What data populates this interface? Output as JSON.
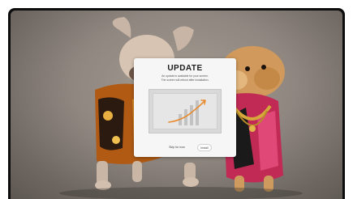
{
  "dialog": {
    "title": "UPDATE",
    "description_line1": "An update is available for your screen.",
    "description_line2": "The screen will reboot after installation.",
    "skip_label": "Skip for now",
    "install_label": "Install"
  },
  "colors": {
    "accent": "#e8892b",
    "dialog_bg": "#f6f6f6",
    "screen_bezel": "#0d0d0d"
  },
  "icons": {
    "illustration": "growth-chart-icon"
  }
}
